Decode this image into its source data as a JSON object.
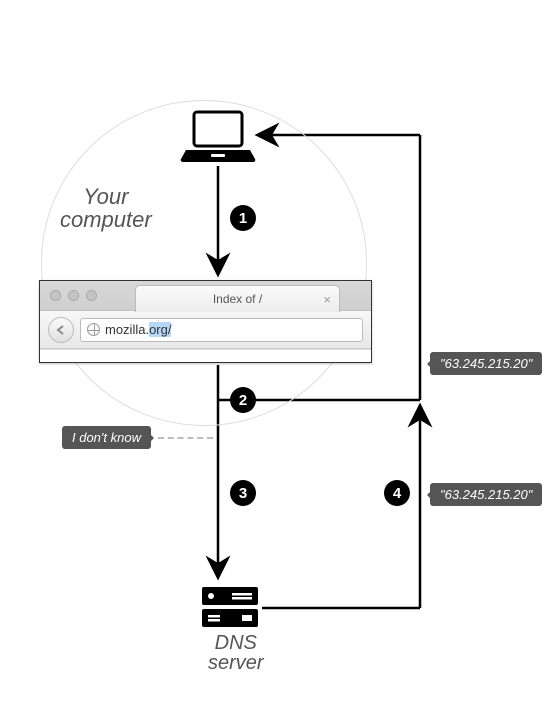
{
  "labels": {
    "computer_line1": "Your",
    "computer_line2": "computer",
    "dns_line1": "DNS",
    "dns_line2": "server"
  },
  "steps": {
    "s1": "1",
    "s2": "2",
    "s3": "3",
    "s4": "4"
  },
  "bubbles": {
    "dont_know": "I don't know",
    "ip_top": "\"63.245.215.20\"",
    "ip_bottom": "\"63.245.215.20\""
  },
  "browser": {
    "tab_title": "Index of /",
    "url_domain": "mozilla.",
    "url_selected": "org/"
  }
}
